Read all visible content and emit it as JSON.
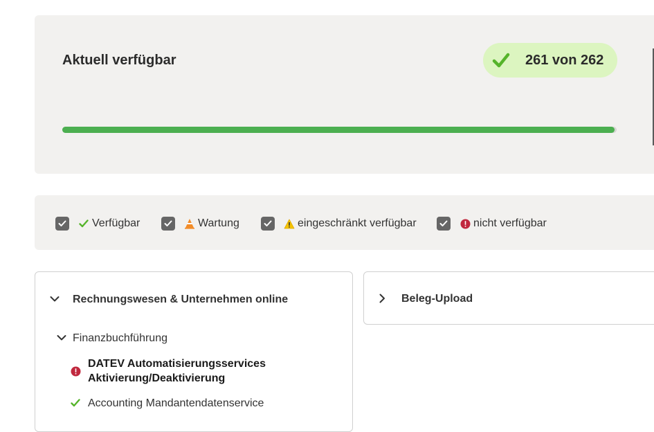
{
  "status": {
    "title": "Aktuell verfügbar",
    "count": "261 von 262",
    "available": 261,
    "total": 262,
    "progress_fraction": 0.9962,
    "colors": {
      "progress": "#4caf50",
      "pill_bg": "#dcf5c0",
      "check": "#55b42a"
    }
  },
  "filters": [
    {
      "label": "Verfügbar",
      "icon": "green-check-icon",
      "checked": true
    },
    {
      "label": "Wartung",
      "icon": "traffic-cone-icon",
      "checked": true
    },
    {
      "label": "eingeschränkt verfügbar",
      "icon": "warning-icon",
      "checked": true
    },
    {
      "label": "nicht verfügbar",
      "icon": "error-icon",
      "checked": true
    }
  ],
  "tree": {
    "group": {
      "label": "Rechnungswesen & Unternehmen online",
      "expanded": true
    },
    "subgroup": {
      "label": "Finanzbuchführung",
      "expanded": true
    },
    "services": [
      {
        "line1": "DATEV Automatisierungsservices",
        "line2": "Aktivierung/Deaktivierung",
        "status": "nicht verfügbar",
        "icon": "error-icon"
      },
      {
        "label": "Accounting Mandantendatenservice",
        "status": "verfügbar",
        "icon": "green-check-icon"
      }
    ]
  },
  "beleg": {
    "label": "Beleg-Upload",
    "expanded": false
  }
}
